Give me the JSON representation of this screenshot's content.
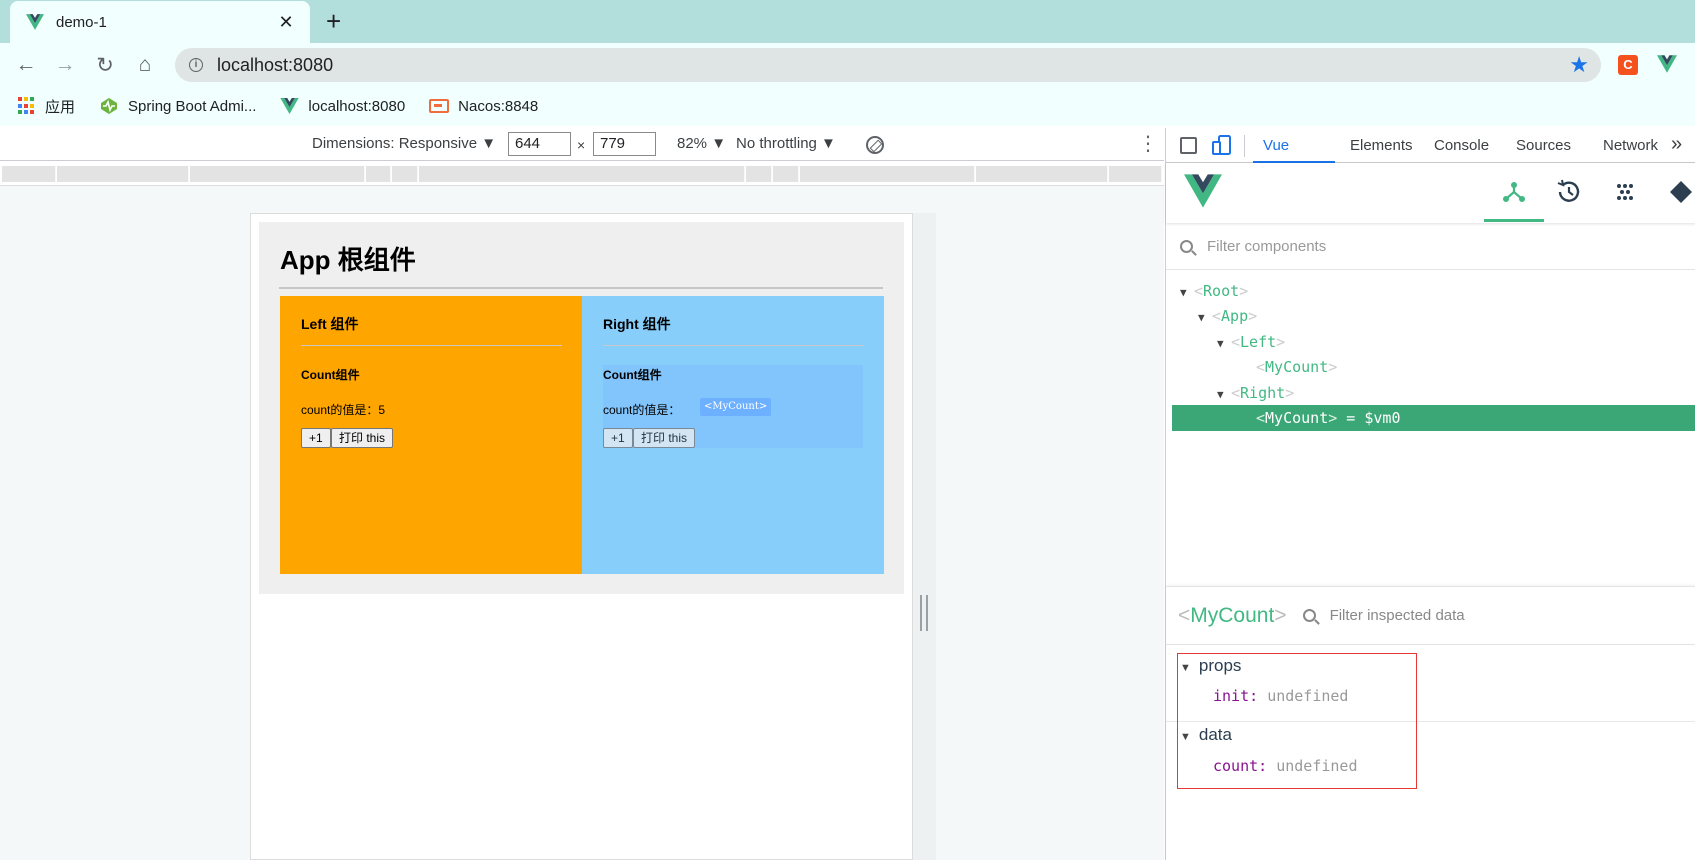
{
  "browser": {
    "tab_title": "demo-1",
    "tab_close": "✕",
    "new_tab": "+",
    "url": "localhost:8080",
    "bookmarks": [
      {
        "label": "应用"
      },
      {
        "label": "Spring Boot Admi..."
      },
      {
        "label": "localhost:8080"
      },
      {
        "label": "Nacos:8848"
      }
    ],
    "extension_label": "C"
  },
  "device_toolbar": {
    "dimensions_label": "Dimensions: Responsive ▼",
    "width": "644",
    "height": "779",
    "times": "×",
    "zoom": "82% ▼",
    "throttling": "No throttling ▼"
  },
  "page": {
    "app_title": "App 根组件",
    "left": {
      "title": "Left 组件",
      "count_title": "Count组件",
      "count_line": "count的值是：5",
      "btn_plus": "+1",
      "btn_print": "打印 this"
    },
    "right": {
      "title": "Right 组件",
      "count_title": "Count组件",
      "count_line": "count的值是：",
      "btn_plus": "+1",
      "btn_print": "打印 this",
      "overlay_tag": "<MyCount>"
    }
  },
  "devtools": {
    "tabs": [
      "Vue",
      "Elements",
      "Console",
      "Sources",
      "Network"
    ],
    "more": "»",
    "filter_placeholder": "Filter components",
    "tree": [
      {
        "name": "Root",
        "suffix": ""
      },
      {
        "name": "App",
        "suffix": ""
      },
      {
        "name": "Left",
        "suffix": ""
      },
      {
        "name": "MyCount",
        "suffix": ""
      },
      {
        "name": "Right",
        "suffix": ""
      },
      {
        "name": "MyCount",
        "suffix": " = $vm0"
      }
    ],
    "inspector": {
      "component": "MyCount",
      "filter_placeholder": "Filter inspected data",
      "sections": [
        {
          "title": "props",
          "key": "init",
          "value": "undefined"
        },
        {
          "title": "data",
          "key": "count",
          "value": "undefined"
        }
      ]
    }
  },
  "colors": {
    "vue_green": "#42b983",
    "selected_row": "#3ba776",
    "left_bg": "#ffa500",
    "right_bg": "#87cefa",
    "tab_strip": "#b2dfdb",
    "highlight_border": "#e53935"
  }
}
